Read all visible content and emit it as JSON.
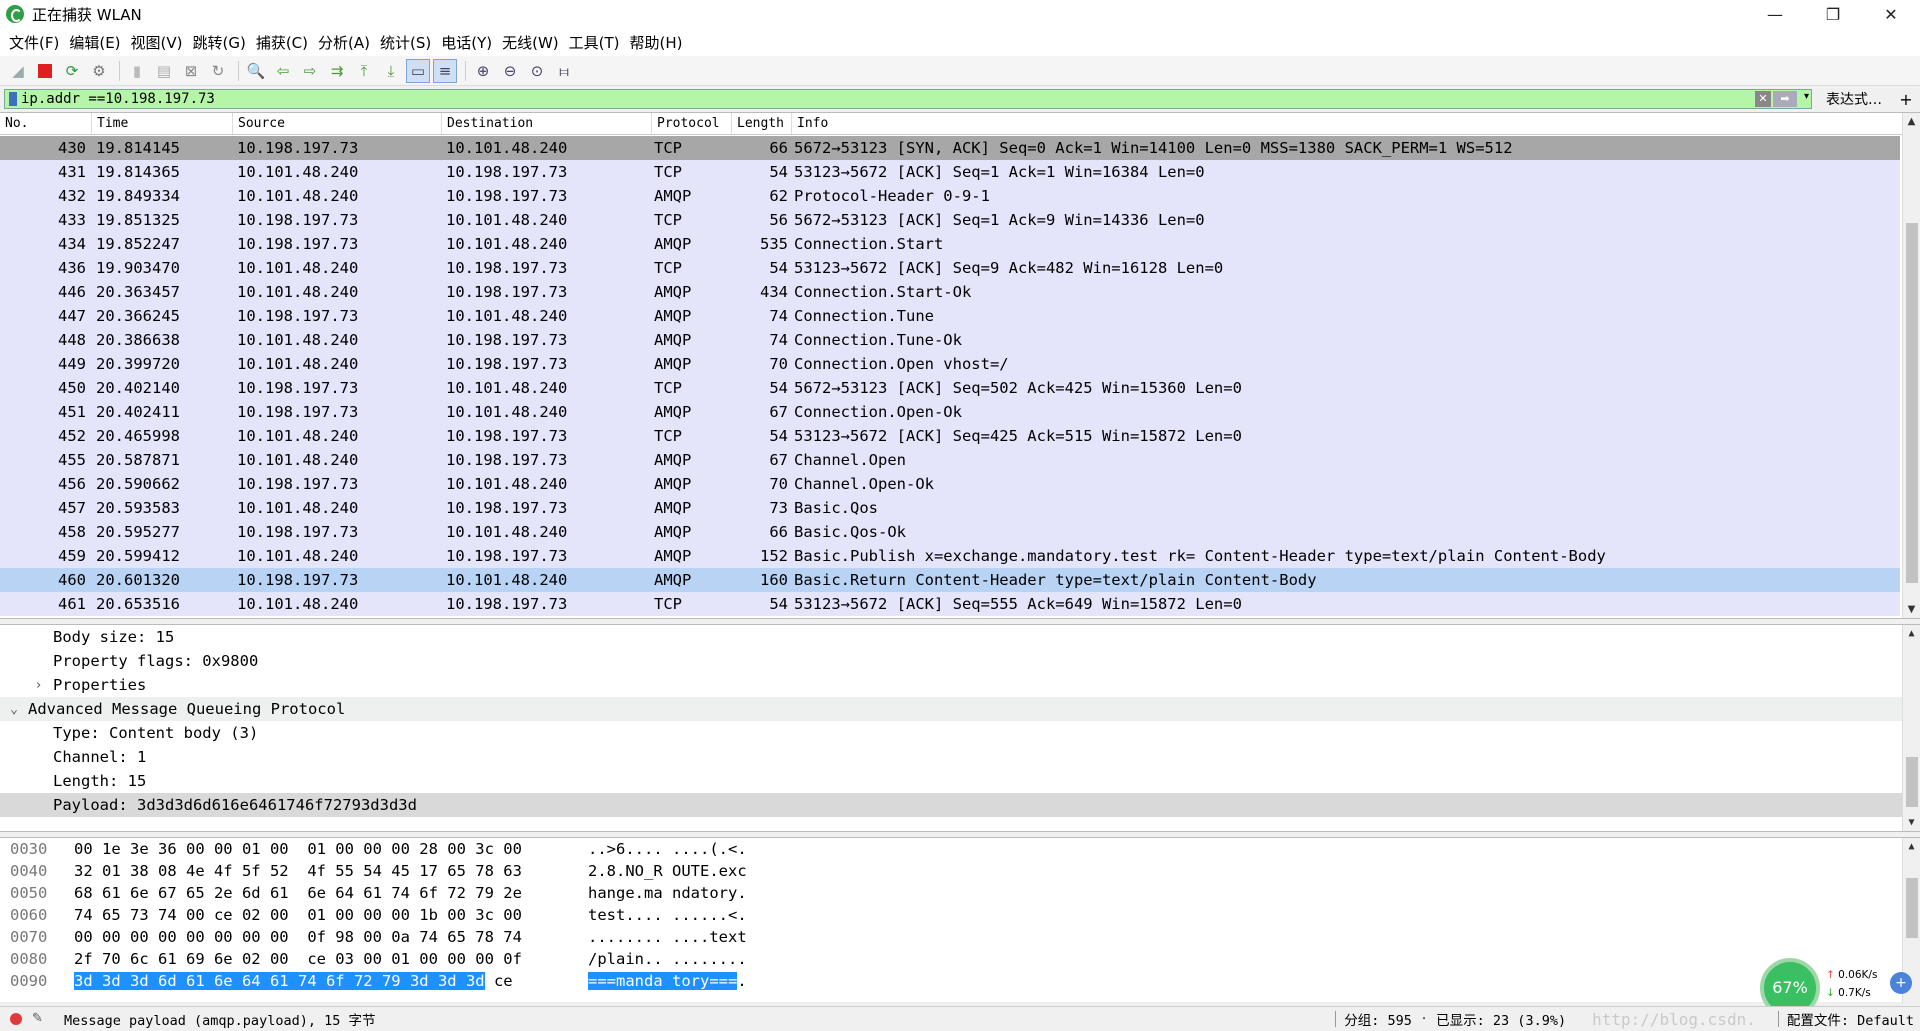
{
  "window": {
    "title": "正在捕获 WLAN",
    "minimize": "—",
    "maximize": "❐",
    "close": "✕"
  },
  "menu": [
    "文件(F)",
    "编辑(E)",
    "视图(V)",
    "跳转(G)",
    "捕获(C)",
    "分析(A)",
    "统计(S)",
    "电话(Y)",
    "无线(W)",
    "工具(T)",
    "帮助(H)"
  ],
  "filter": {
    "value": "ip.addr ==10.198.197.73",
    "expression_label": "表达式…",
    "add_label": "+"
  },
  "columns": [
    "No.",
    "Time",
    "Source",
    "Destination",
    "Protocol",
    "Length",
    "Info"
  ],
  "packets": [
    {
      "no": "430",
      "time": "19.814145",
      "src": "10.198.197.73",
      "dst": "10.101.48.240",
      "proto": "TCP",
      "len": "66",
      "info": "5672→53123 [SYN, ACK] Seq=0 Ack=1 Win=14100 Len=0 MSS=1380 SACK_PERM=1 WS=512"
    },
    {
      "no": "431",
      "time": "19.814365",
      "src": "10.101.48.240",
      "dst": "10.198.197.73",
      "proto": "TCP",
      "len": "54",
      "info": "53123→5672 [ACK] Seq=1 Ack=1 Win=16384 Len=0"
    },
    {
      "no": "432",
      "time": "19.849334",
      "src": "10.101.48.240",
      "dst": "10.198.197.73",
      "proto": "AMQP",
      "len": "62",
      "info": "Protocol-Header 0-9-1"
    },
    {
      "no": "433",
      "time": "19.851325",
      "src": "10.198.197.73",
      "dst": "10.101.48.240",
      "proto": "TCP",
      "len": "56",
      "info": "5672→53123 [ACK] Seq=1 Ack=9 Win=14336 Len=0"
    },
    {
      "no": "434",
      "time": "19.852247",
      "src": "10.198.197.73",
      "dst": "10.101.48.240",
      "proto": "AMQP",
      "len": "535",
      "info": "Connection.Start"
    },
    {
      "no": "436",
      "time": "19.903470",
      "src": "10.101.48.240",
      "dst": "10.198.197.73",
      "proto": "TCP",
      "len": "54",
      "info": "53123→5672 [ACK] Seq=9 Ack=482 Win=16128 Len=0"
    },
    {
      "no": "446",
      "time": "20.363457",
      "src": "10.101.48.240",
      "dst": "10.198.197.73",
      "proto": "AMQP",
      "len": "434",
      "info": "Connection.Start-Ok"
    },
    {
      "no": "447",
      "time": "20.366245",
      "src": "10.198.197.73",
      "dst": "10.101.48.240",
      "proto": "AMQP",
      "len": "74",
      "info": "Connection.Tune"
    },
    {
      "no": "448",
      "time": "20.386638",
      "src": "10.101.48.240",
      "dst": "10.198.197.73",
      "proto": "AMQP",
      "len": "74",
      "info": "Connection.Tune-Ok"
    },
    {
      "no": "449",
      "time": "20.399720",
      "src": "10.101.48.240",
      "dst": "10.198.197.73",
      "proto": "AMQP",
      "len": "70",
      "info": "Connection.Open vhost=/"
    },
    {
      "no": "450",
      "time": "20.402140",
      "src": "10.198.197.73",
      "dst": "10.101.48.240",
      "proto": "TCP",
      "len": "54",
      "info": "5672→53123 [ACK] Seq=502 Ack=425 Win=15360 Len=0"
    },
    {
      "no": "451",
      "time": "20.402411",
      "src": "10.198.197.73",
      "dst": "10.101.48.240",
      "proto": "AMQP",
      "len": "67",
      "info": "Connection.Open-Ok"
    },
    {
      "no": "452",
      "time": "20.465998",
      "src": "10.101.48.240",
      "dst": "10.198.197.73",
      "proto": "TCP",
      "len": "54",
      "info": "53123→5672 [ACK] Seq=425 Ack=515 Win=15872 Len=0"
    },
    {
      "no": "455",
      "time": "20.587871",
      "src": "10.101.48.240",
      "dst": "10.198.197.73",
      "proto": "AMQP",
      "len": "67",
      "info": "Channel.Open"
    },
    {
      "no": "456",
      "time": "20.590662",
      "src": "10.198.197.73",
      "dst": "10.101.48.240",
      "proto": "AMQP",
      "len": "70",
      "info": "Channel.Open-Ok"
    },
    {
      "no": "457",
      "time": "20.593583",
      "src": "10.101.48.240",
      "dst": "10.198.197.73",
      "proto": "AMQP",
      "len": "73",
      "info": "Basic.Qos"
    },
    {
      "no": "458",
      "time": "20.595277",
      "src": "10.198.197.73",
      "dst": "10.101.48.240",
      "proto": "AMQP",
      "len": "66",
      "info": "Basic.Qos-Ok"
    },
    {
      "no": "459",
      "time": "20.599412",
      "src": "10.101.48.240",
      "dst": "10.198.197.73",
      "proto": "AMQP",
      "len": "152",
      "info": "Basic.Publish x=exchange.mandatory.test rk= Content-Header type=text/plain Content-Body"
    },
    {
      "no": "460",
      "time": "20.601320",
      "src": "10.198.197.73",
      "dst": "10.101.48.240",
      "proto": "AMQP",
      "len": "160",
      "info": "Basic.Return Content-Header type=text/plain Content-Body"
    },
    {
      "no": "461",
      "time": "20.653516",
      "src": "10.101.48.240",
      "dst": "10.198.197.73",
      "proto": "TCP",
      "len": "54",
      "info": "53123→5672 [ACK] Seq=555 Ack=649 Win=15872 Len=0"
    }
  ],
  "details": [
    {
      "text": "Body size: 15",
      "level": 1,
      "chevron": ""
    },
    {
      "text": "Property flags: 0x9800",
      "level": 1,
      "chevron": ""
    },
    {
      "text": "Properties",
      "level": 1,
      "chevron": "›"
    },
    {
      "text": "Advanced Message Queueing Protocol",
      "level": 0,
      "chevron": "⌄"
    },
    {
      "text": "Type: Content body (3)",
      "level": 1,
      "chevron": ""
    },
    {
      "text": "Channel: 1",
      "level": 1,
      "chevron": ""
    },
    {
      "text": "Length: 15",
      "level": 1,
      "chevron": ""
    },
    {
      "text": "Payload: 3d3d3d6d616e6461746f72793d3d3d",
      "level": 1,
      "chevron": ""
    }
  ],
  "bytes": [
    {
      "off": "0030",
      "hex_a": "00 1e 3e 36 00 00 01 00",
      "hex_b": "01 00 00 00 28 00 3c 00",
      "asc_a": "..>6....",
      "asc_b": "....(.<."
    },
    {
      "off": "0040",
      "hex_a": "32 01 38 08 4e 4f 5f 52",
      "hex_b": "4f 55 54 45 17 65 78 63",
      "asc_a": "2.8.NO_R",
      "asc_b": "OUTE.exc"
    },
    {
      "off": "0050",
      "hex_a": "68 61 6e 67 65 2e 6d 61",
      "hex_b": "6e 64 61 74 6f 72 79 2e",
      "asc_a": "hange.ma",
      "asc_b": "ndatory."
    },
    {
      "off": "0060",
      "hex_a": "74 65 73 74 00 ce 02 00",
      "hex_b": "01 00 00 00 1b 00 3c 00",
      "asc_a": "test....",
      "asc_b": "......<."
    },
    {
      "off": "0070",
      "hex_a": "00 00 00 00 00 00 00 00",
      "hex_b": "0f 98 00 0a 74 65 78 74",
      "asc_a": "........",
      "asc_b": "....text"
    },
    {
      "off": "0080",
      "hex_a": "2f 70 6c 61 69 6e 02 00",
      "hex_b": "ce 03 00 01 00 00 00 0f",
      "asc_a": "/plain..",
      "asc_b": "........"
    }
  ],
  "bytes_last": {
    "off": "0090",
    "hex_hl_a": "3d 3d 3d 6d 61 6e 64 61",
    "hex_hl_b": "74 6f 72 79 3d 3d 3d",
    "hex_tail": "ce",
    "asc_hl_a": "===manda",
    "asc_hl_b": "tory===",
    "asc_tail": "."
  },
  "netwidget": {
    "percent": "67%",
    "up": "0.06K/s",
    "down": "0.7K/s",
    "up_icon": "↑",
    "down_icon": "↓",
    "boost_icon": "+"
  },
  "status": {
    "message": "Message payload (amqp.payload), 15 字节",
    "groups": "分组: 595",
    "displayed": "已显示: 23 (3.9%)",
    "profile": "配置文件: Default",
    "watermark": "http://blog.csdn."
  },
  "colors": {
    "selected_gray": "#a7a7a7",
    "selected_blue": "#b9d3f5",
    "row_bg": "#e4e4fa",
    "filter_bg": "#b5f5a7",
    "highlight": "#1e90ff"
  }
}
